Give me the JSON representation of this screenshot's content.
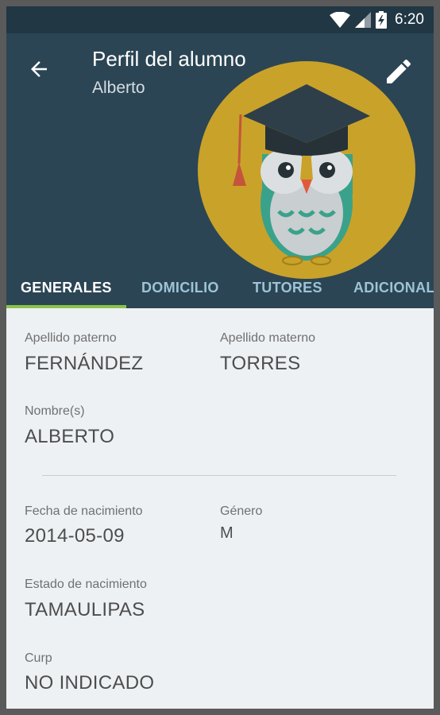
{
  "status_bar": {
    "time": "6:20"
  },
  "app_bar": {
    "title": "Perfil del alumno",
    "subtitle": "Alberto"
  },
  "tabs": [
    {
      "label": "GENERALES",
      "active": true
    },
    {
      "label": "DOMICILIO",
      "active": false
    },
    {
      "label": "TUTORES",
      "active": false
    },
    {
      "label": "ADICIONAL",
      "active": false
    }
  ],
  "fields": {
    "apellido_paterno": {
      "label": "Apellido paterno",
      "value": "FERNÁNDEZ"
    },
    "apellido_materno": {
      "label": "Apellido materno",
      "value": "TORRES"
    },
    "nombres": {
      "label": "Nombre(s)",
      "value": "ALBERTO"
    },
    "fecha_nacimiento": {
      "label": "Fecha de nacimiento",
      "value": "2014-05-09"
    },
    "genero": {
      "label": "Género",
      "value": "M"
    },
    "estado_nacimiento": {
      "label": "Estado de nacimiento",
      "value": "TAMAULIPAS"
    },
    "curp": {
      "label": "Curp",
      "value": "NO INDICADO"
    }
  },
  "colors": {
    "app_bar": "#2b4554",
    "status_bar": "#213744",
    "tab_indicator": "#8bc34a",
    "avatar_circle": "#c9a22a"
  },
  "icons": [
    "wifi-icon",
    "signal-icon",
    "battery-charging-icon",
    "back-arrow-icon",
    "edit-pencil-icon",
    "owl-graduate-avatar"
  ]
}
